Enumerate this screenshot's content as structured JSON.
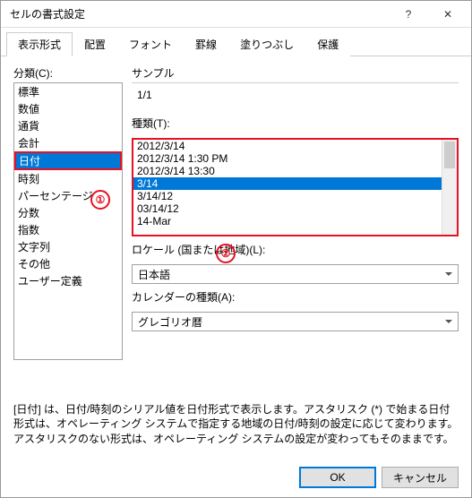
{
  "title": "セルの書式設定",
  "tabs": [
    "表示形式",
    "配置",
    "フォント",
    "罫線",
    "塗りつぶし",
    "保護"
  ],
  "active_tab": 0,
  "category_label": "分類(C):",
  "categories": [
    "標準",
    "数値",
    "通貨",
    "会計",
    "日付",
    "時刻",
    "パーセンテージ",
    "分数",
    "指数",
    "文字列",
    "その他",
    "ユーザー定義"
  ],
  "selected_category": 4,
  "sample_label": "サンプル",
  "sample_value": "1/1",
  "type_label": "種類(T):",
  "types": [
    "2012/3/14",
    "2012/3/14 1:30 PM",
    "2012/3/14 13:30",
    "3/14",
    "3/14/12",
    "03/14/12",
    "14-Mar"
  ],
  "selected_type": 3,
  "locale_label": "ロケール (国または地域)(L):",
  "locale_value": "日本語",
  "calendar_label": "カレンダーの種類(A):",
  "calendar_value": "グレゴリオ暦",
  "description": "[日付] は、日付/時刻のシリアル値を日付形式で表示します。アスタリスク (*) で始まる日付形式は、オペレーティング システムで指定する地域の日付/時刻の設定に応じて変わります。アスタリスクのない形式は、オペレーティング システムの設定が変わってもそのままです。",
  "ok": "OK",
  "cancel": "キャンセル",
  "callout1": "①",
  "callout2": "②"
}
